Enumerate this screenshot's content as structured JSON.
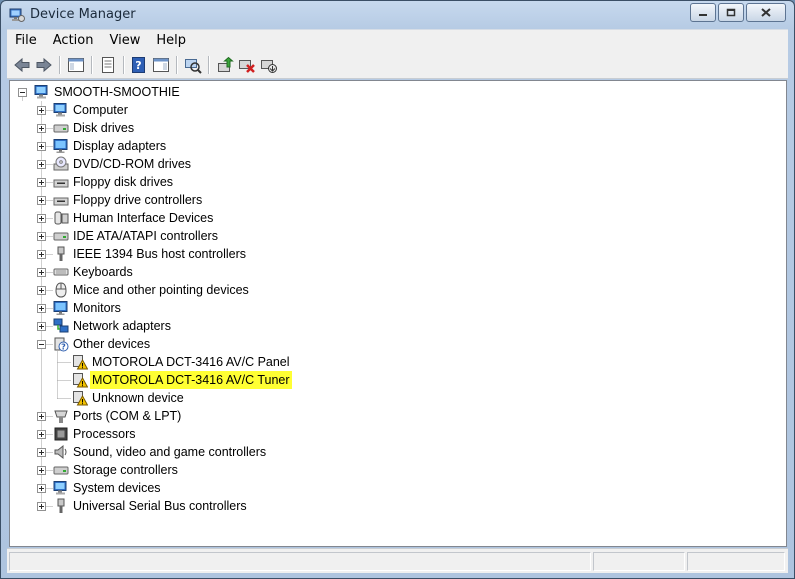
{
  "window": {
    "title": "Device Manager"
  },
  "menu": [
    {
      "label": "File"
    },
    {
      "label": "Action"
    },
    {
      "label": "View"
    },
    {
      "label": "Help"
    }
  ],
  "tree": {
    "root": "SMOOTH-SMOOTHIE",
    "categories": [
      {
        "label": "Computer",
        "icon": "computer-icon"
      },
      {
        "label": "Disk drives",
        "icon": "disk-drive-icon"
      },
      {
        "label": "Display adapters",
        "icon": "display-adapter-icon"
      },
      {
        "label": "DVD/CD-ROM drives",
        "icon": "dvd-drive-icon"
      },
      {
        "label": "Floppy disk drives",
        "icon": "floppy-drive-icon"
      },
      {
        "label": "Floppy drive controllers",
        "icon": "floppy-controller-icon"
      },
      {
        "label": "Human Interface Devices",
        "icon": "hid-icon"
      },
      {
        "label": "IDE ATA/ATAPI controllers",
        "icon": "ide-controller-icon"
      },
      {
        "label": "IEEE 1394 Bus host controllers",
        "icon": "ieee1394-icon"
      },
      {
        "label": "Keyboards",
        "icon": "keyboard-icon"
      },
      {
        "label": "Mice and other pointing devices",
        "icon": "mouse-icon"
      },
      {
        "label": "Monitors",
        "icon": "monitor-icon"
      },
      {
        "label": "Network adapters",
        "icon": "network-adapter-icon"
      },
      {
        "label": "Other devices",
        "icon": "other-devices-icon",
        "expanded": true,
        "children": [
          {
            "label": "MOTOROLA DCT-3416 AV/C Panel",
            "icon": "warning-device-icon"
          },
          {
            "label": "MOTOROLA DCT-3416 AV/C Tuner",
            "icon": "warning-device-icon",
            "highlighted": true
          },
          {
            "label": "Unknown device",
            "icon": "warning-device-icon"
          }
        ]
      },
      {
        "label": "Ports (COM & LPT)",
        "icon": "ports-icon"
      },
      {
        "label": "Processors",
        "icon": "processor-icon"
      },
      {
        "label": "Sound, video and game controllers",
        "icon": "sound-icon"
      },
      {
        "label": "Storage controllers",
        "icon": "storage-controller-icon"
      },
      {
        "label": "System devices",
        "icon": "system-devices-icon"
      },
      {
        "label": "Universal Serial Bus controllers",
        "icon": "usb-icon"
      }
    ]
  },
  "colors": {
    "highlight": "#ffff33",
    "warning": "#f2c200"
  }
}
